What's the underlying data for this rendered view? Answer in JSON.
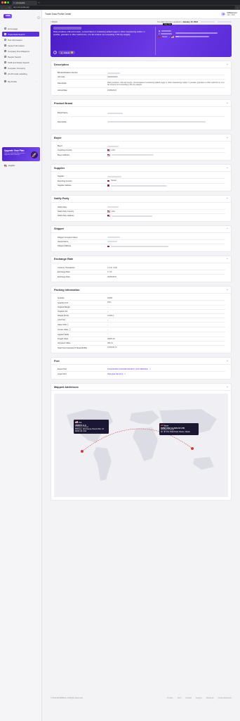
{
  "browser": {
    "tab_title": "eximpedia",
    "url": "app.eximpedia.app"
  },
  "sidebar": {
    "logo": "EXIM",
    "items": [
      {
        "label": "Homepage",
        "icon": "home-icon",
        "active": false
      },
      {
        "label": "Trade Data Search",
        "icon": "search-icon",
        "active": true
      },
      {
        "label": "Port Information",
        "icon": "anchor-icon",
        "active": false
      },
      {
        "label": "Vessel Information",
        "icon": "ship-icon",
        "active": false
      },
      {
        "label": "Company Due Diligence",
        "icon": "building-icon",
        "active": false
      },
      {
        "label": "People Search",
        "icon": "people-icon",
        "active": false
      },
      {
        "label": "Tariff and Duties Search",
        "icon": "tariff-icon",
        "active": false
      },
      {
        "label": "Compare Company",
        "icon": "compare-icon",
        "active": false
      },
      {
        "label": "AI HS Code Labelling",
        "icon": "ai-icon",
        "active": false
      },
      {
        "label": "My Profile",
        "icon": "user-icon",
        "active": false
      }
    ],
    "upgrade_title": "Upgrade Your Plan",
    "upgrade_sub": "Gain an unlimited data access upgrade plan to the pro",
    "language": "English"
  },
  "header": {
    "page_title": "Trade Data Profile Detail",
    "user_name": "Williamson",
    "user_credits": "400 / 1000",
    "avatar_initial": "W"
  },
  "subbar": {
    "back": "< BACK",
    "updated_prefix": "The data has been updated in",
    "updated_date": "January 15, 2024"
  },
  "hero": {
    "description": "Dairy produce; milk and cream, concentrated or containing added sugar or other sweetening matter, in powder, granules or other solid forms, of a fat content not exceeding 1.5% (by weight)",
    "share_icon": "share-icon",
    "unlock_label": "Unlock",
    "tooltip": "Copy Text",
    "origin_country": "Taiwan",
    "dest_country": "USA"
  },
  "description": {
    "title": "Description",
    "rows": [
      {
        "label": "Bill Identification Number",
        "value": ""
      },
      {
        "label": "HS Code",
        "value": "0402100000"
      },
      {
        "label": "Description",
        "value": "Dairy produce; milk and cream, concentrated or containing added sugar or other sweetening matter; in powder, granules or other solid forms, of a fat content not exceeding 1.5% (by weight)"
      },
      {
        "label": "Arrival Date",
        "value": "15/05/2023"
      }
    ]
  },
  "product_brand": {
    "title": "Product Brand",
    "rows": [
      {
        "label": "Brand Name",
        "value": ""
      },
      {
        "label": "Description",
        "value": ""
      }
    ]
  },
  "buyer": {
    "title": "Buyer",
    "rows": [
      {
        "label": "Buyer",
        "value": ""
      },
      {
        "label": "Importing Country",
        "value": "USA"
      },
      {
        "label": "Buyer Address",
        "value": ""
      }
    ]
  },
  "supplier": {
    "title": "Supplier",
    "rows": [
      {
        "label": "Supplier",
        "value": ""
      },
      {
        "label": "Exporting Country",
        "value": "Taiwan"
      },
      {
        "label": "Supplier Address",
        "value": ""
      }
    ]
  },
  "notify": {
    "title": "Notify Party",
    "rows": [
      {
        "label": "Notify Party",
        "value": ""
      },
      {
        "label": "Notify Party Country",
        "value": "USA"
      },
      {
        "label": "Notify Party Address",
        "value": ""
      }
    ]
  },
  "shipper": {
    "title": "Shipper",
    "rows": [
      {
        "label": "Shipper Company Name",
        "value": ""
      },
      {
        "label": "Vessel Name",
        "value": ""
      },
      {
        "label": "Shipper Address",
        "value": ""
      }
    ]
  },
  "exchange": {
    "title": "Exchange Rate",
    "rows": [
      {
        "label": "Currency Transaction",
        "value": "U.S.D. USD"
      },
      {
        "label": "Exchange Rate",
        "value": "17.23"
      },
      {
        "label": "Exchange Date",
        "value": "02/05/2023"
      }
    ]
  },
  "packing": {
    "title": "Packing Information",
    "rows": [
      {
        "label": "Quantity",
        "value": "40000"
      },
      {
        "label": "Quantity Unit",
        "value": "PKG"
      },
      {
        "label": "Original Weight",
        "value": "–"
      },
      {
        "label": "Original Unit",
        "value": "–"
      },
      {
        "label": "Weight (KGS)",
        "value": "11000.0"
      },
      {
        "label": "Unit Price",
        "value": "–"
      },
      {
        "label": "Value USD ⓘ",
        "value": "–"
      },
      {
        "label": "Invoice Value ⓘ",
        "value": "–"
      },
      {
        "label": "Applied Tariffs",
        "value": "–"
      },
      {
        "label": "Freight Value",
        "value": "39953.03"
      },
      {
        "label": "Insurance Value",
        "value": "383.41"
      },
      {
        "label": "Total Cost (Inclusive of Taxes/Tariffs)",
        "value": "1005145.71"
      }
    ]
  },
  "port": {
    "title": "Port",
    "rows": [
      {
        "label": "Export Port",
        "value": "KAOHSIUNG (KAOHSIUNG BAY) (KAOTERUNG)"
      },
      {
        "label": "Import Port",
        "value": "Shanghai (SE.Port)"
      }
    ]
  },
  "mapped": {
    "title": "Mapped Addresses",
    "buyer_country": "USA",
    "buyer_name": "VERITIV  LLC",
    "buyer_sub": "Company of Origin",
    "buyer_addr": "5950 Ave. 11th Avenue, Buena Park, CA 90620 US, USA",
    "supplier_country": "Taiwan",
    "supplier_name": "FMSR HSIA GLASS CO LTD",
    "supplier_sub": "Company of Origin",
    "supplier_addr": "No. 48, Pou Chiao Road, Shetou, Taiwan"
  },
  "footer": {
    "copyright": "© 2023 EXIMPEDIA. All Rights Reserved.",
    "links": [
      "Privacy",
      "Term",
      "Contact",
      "Support",
      "Roadmap",
      "Quote Resources"
    ]
  },
  "colors": {
    "brand": "#5b2fd8",
    "hero_start": "#4a1cc4",
    "hero_end": "#6d3ae6"
  }
}
